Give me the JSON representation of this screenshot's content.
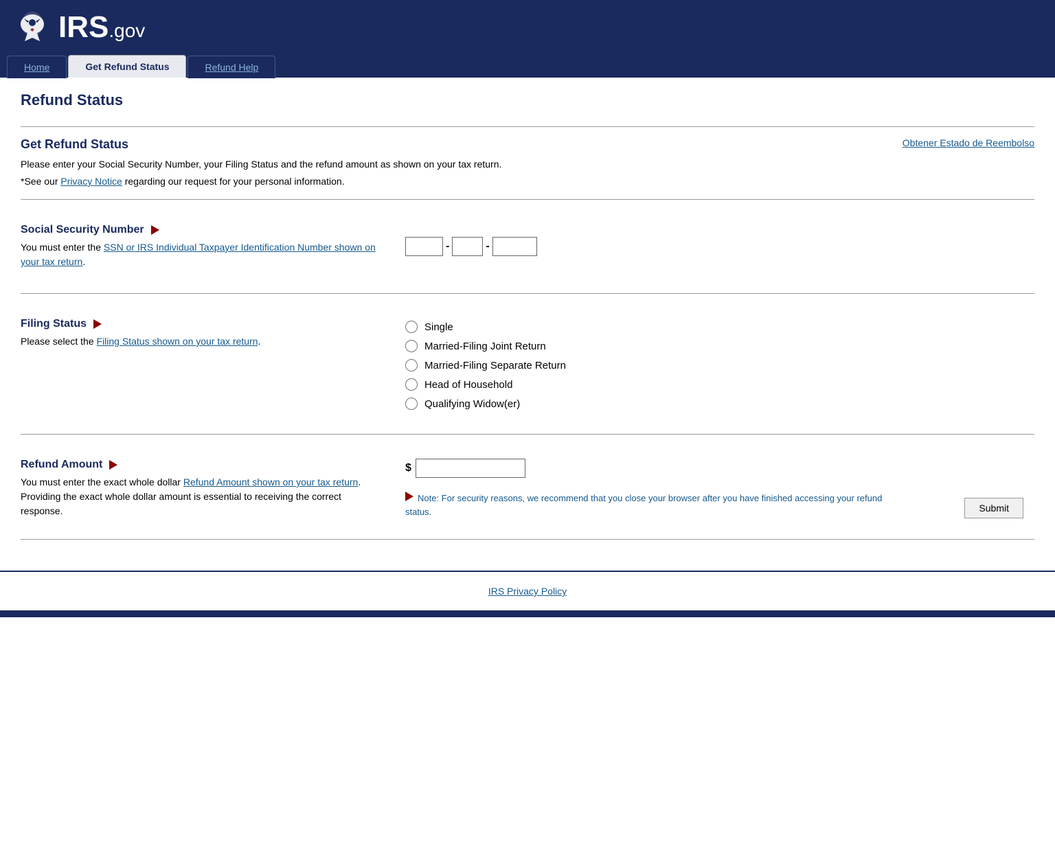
{
  "header": {
    "logo_text": "IRS",
    "logo_suffix": ".gov"
  },
  "nav": {
    "tabs": [
      {
        "label": "Home",
        "active": false
      },
      {
        "label": "Get Refund Status",
        "active": true
      },
      {
        "label": "Refund Help",
        "active": false
      }
    ]
  },
  "page": {
    "title": "Refund Status",
    "spanish_link": "Obtener Estado de Reembolso",
    "section_title": "Get Refund Status",
    "intro_line1": "Please enter your Social Security Number, your Filing Status and the refund amount as shown on your tax return.",
    "intro_line2": "*See our ",
    "privacy_link_text": "Privacy Notice",
    "intro_line2_cont": " regarding our request for your personal information.",
    "ssn": {
      "title": "Social Security Number",
      "description": "You must enter the ",
      "ssn_link_text": "SSN or IRS Individual Taxpayer Identification Number shown on your tax return",
      "description_end": ".",
      "placeholder1": "",
      "placeholder2": "",
      "placeholder3": ""
    },
    "filing_status": {
      "title": "Filing Status",
      "description": "Please select the ",
      "link_text": "Filing Status shown on your tax return",
      "description_end": ".",
      "options": [
        {
          "label": "Single",
          "value": "single"
        },
        {
          "label": "Married-Filing Joint Return",
          "value": "married_joint"
        },
        {
          "label": "Married-Filing Separate Return",
          "value": "married_separate"
        },
        {
          "label": "Head of Household",
          "value": "head_of_household"
        },
        {
          "label": "Qualifying Widow(er)",
          "value": "qualifying_widow"
        }
      ]
    },
    "refund_amount": {
      "title": "Refund Amount",
      "description": "You must enter the exact whole dollar ",
      "link_text": "Refund Amount shown on your tax return",
      "description_cont": ". Providing the exact whole dollar amount is essential to receiving the correct response.",
      "placeholder": ""
    },
    "note": "Note: For security reasons, we recommend that you close your browser after you have finished accessing your refund status.",
    "submit_label": "Submit",
    "footer_link": "IRS Privacy Policy"
  }
}
